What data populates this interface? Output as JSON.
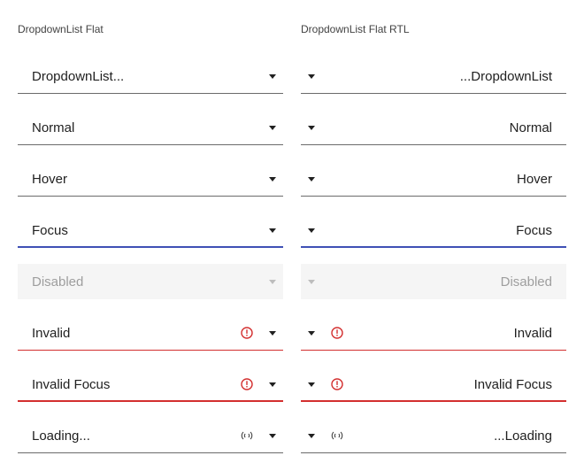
{
  "ltr": {
    "title": "DropdownList Flat",
    "rows": [
      {
        "label": "DropdownList..."
      },
      {
        "label": "Normal"
      },
      {
        "label": "Hover"
      },
      {
        "label": "Focus"
      },
      {
        "label": "Disabled"
      },
      {
        "label": "Invalid",
        "icon": "error-circle-icon"
      },
      {
        "label": "Invalid Focus",
        "icon": "error-circle-icon"
      },
      {
        "label": "Loading...",
        "icon": "loading-icon"
      }
    ]
  },
  "rtl": {
    "title": "DropdownList Flat RTL",
    "rows": [
      {
        "label": "DropdownList..."
      },
      {
        "label": "Normal"
      },
      {
        "label": "Hover"
      },
      {
        "label": "Focus"
      },
      {
        "label": "Disabled"
      },
      {
        "label": "Invalid",
        "icon": "error-circle-icon"
      },
      {
        "label": "Invalid Focus",
        "icon": "error-circle-icon"
      },
      {
        "label": "Loading...",
        "icon": "loading-icon"
      }
    ]
  },
  "colors": {
    "text": "#212121",
    "border": "#6b6b6b",
    "focus": "#3f51b5",
    "invalid": "#d32f2f",
    "disabled_bg": "#f5f5f5",
    "disabled_text": "#9e9e9e"
  }
}
